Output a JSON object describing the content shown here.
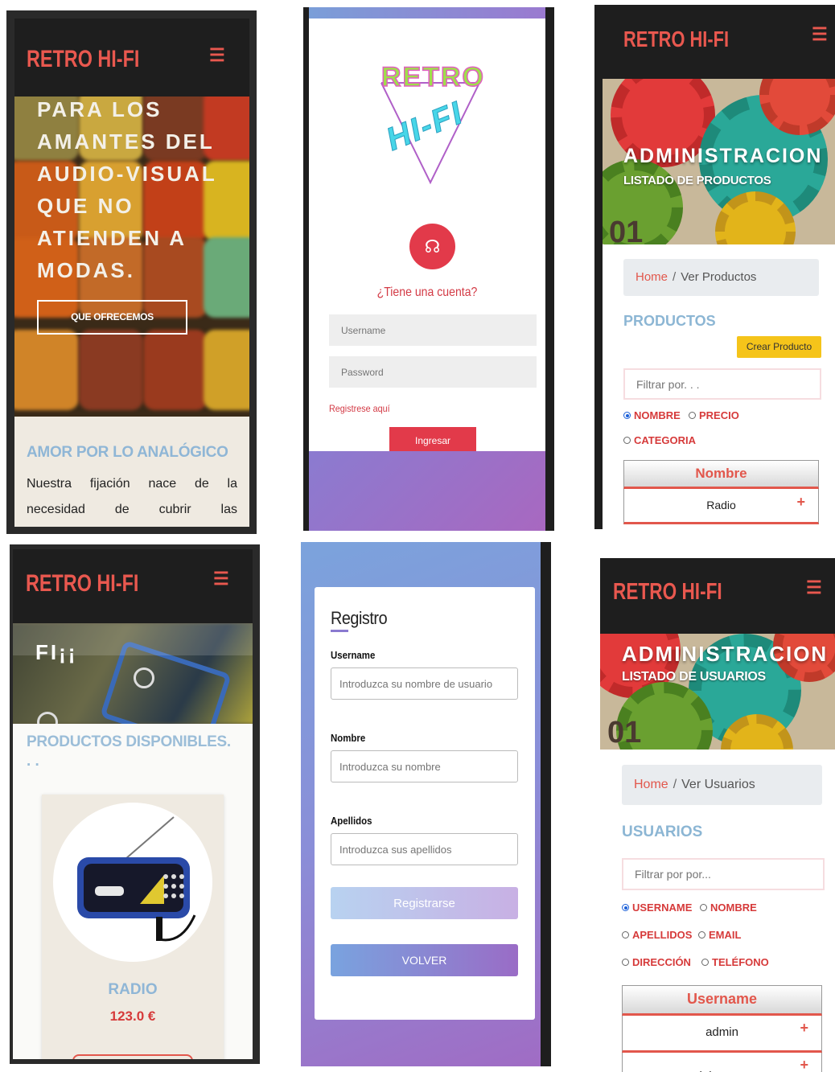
{
  "brand": "RETRO HI-FI",
  "menu_icon": "hamburger-icon",
  "home": {
    "hero_text": "PARA LOS AMANTES DEL AUDIO-VISUAL QUE NO ATIENDEN A MODAS.",
    "cta_button": "QUE OFRECEMOS",
    "section_title": "AMOR POR LO ANALÓGICO",
    "section_text": "Nuestra fijación nace de la necesidad de cubrir las"
  },
  "login": {
    "logo_top": "RETRO",
    "logo_bottom": "HI-FI",
    "question": "¿Tiene una cuenta?",
    "username_placeholder": "Username",
    "password_placeholder": "Password",
    "register_link": "Registrese aquí",
    "submit": "Ingresar"
  },
  "admin_products": {
    "banner_title": "ADMINISTRACION",
    "banner_subtitle": "LISTADO DE PRODUCTOS",
    "banner_number": "01",
    "breadcrumb_home": "Home",
    "breadcrumb_sep": "/",
    "breadcrumb_current": "Ver Productos",
    "section_title": "PRODUCTOS",
    "create_button": "Crear Producto",
    "filter_placeholder": "Filtrar por. . .",
    "radios": [
      "NOMBRE",
      "PRECIO",
      "CATEGORIA"
    ],
    "selected_radio": "NOMBRE",
    "table_header": "Nombre",
    "rows": [
      "Radio"
    ]
  },
  "catalog": {
    "hero_text": "FI¡¡",
    "section_title": "PRODUCTOS DISPONIBLES.",
    "section_dots": ". .",
    "product_name": "RADIO",
    "product_price": "123.0 €"
  },
  "register": {
    "title": "Registro",
    "username_label": "Username",
    "username_placeholder": "Introduzca su nombre de usuario",
    "name_label": "Nombre",
    "name_placeholder": "Introduzca su nombre",
    "surname_label": "Apellidos",
    "surname_placeholder": "Introduzca sus apellidos",
    "submit": "Registrarse",
    "back": "VOLVER"
  },
  "admin_users": {
    "banner_title": "ADMINISTRACION",
    "banner_subtitle": "LISTADO DE USUARIOS",
    "banner_number": "01",
    "breadcrumb_home": "Home",
    "breadcrumb_sep": "/",
    "breadcrumb_current": "Ver Usuarios",
    "section_title": "USUARIOS",
    "filter_placeholder": "Filtrar por por...",
    "radios": [
      "USERNAME",
      "NOMBRE",
      "APELLIDOS",
      "EMAIL",
      "DIRECCIÓN",
      "TELÉFONO"
    ],
    "selected_radio": "USERNAME",
    "table_header": "Username",
    "rows": [
      "admin",
      "johnDoe"
    ]
  },
  "colors": {
    "brand_red": "#e9584f",
    "header_dark": "#1e1e1e",
    "section_blue": "#8fb6d6",
    "accent_yellow": "#f5c41a"
  }
}
